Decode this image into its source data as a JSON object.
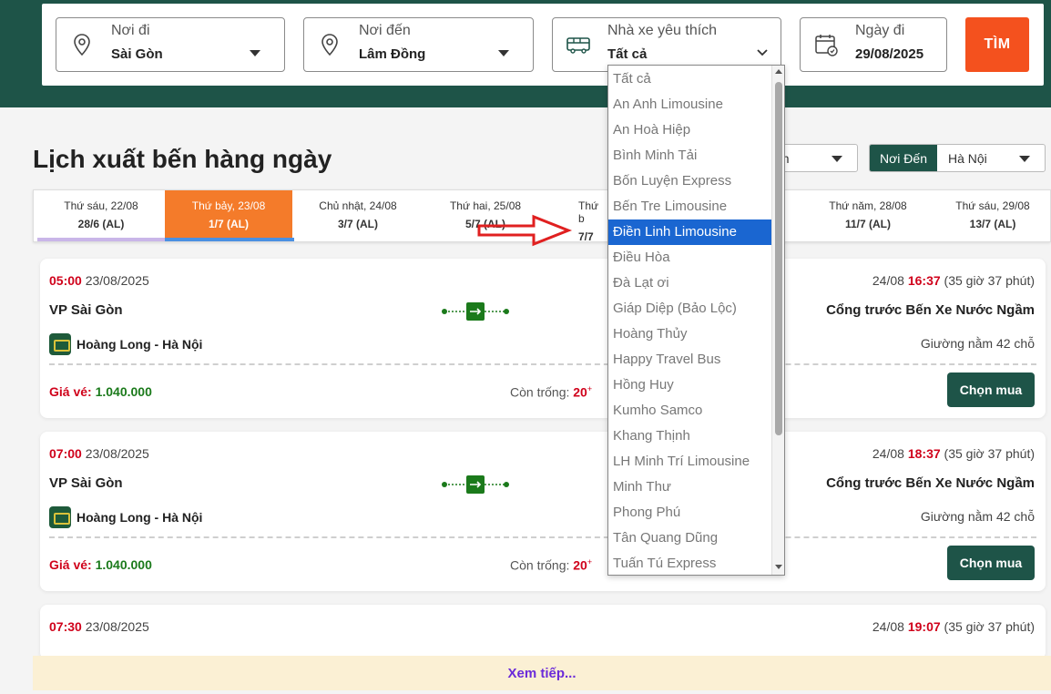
{
  "search": {
    "origin": {
      "label": "Nơi đi",
      "value": "Sài Gòn"
    },
    "destination": {
      "label": "Nơi đến",
      "value": "Lâm Đồng"
    },
    "operator": {
      "label": "Nhà xe yêu thích",
      "value": "Tất cả"
    },
    "date": {
      "label": "Ngày đi",
      "value": "29/08/2025"
    },
    "button_label": "TÌM"
  },
  "page_title": "Lịch xuất bến hàng ngày",
  "filters": {
    "first_value": "ồn",
    "destination_label": "Nơi Đến",
    "destination_value": "Hà Nội"
  },
  "date_tabs": [
    {
      "day": "Thứ sáu, 22/08",
      "lunar": "28/6 (AL)"
    },
    {
      "day": "Thứ bảy, 23/08",
      "lunar": "1/7 (AL)"
    },
    {
      "day": "Chủ nhật, 24/08",
      "lunar": "3/7 (AL)"
    },
    {
      "day": "Thứ hai, 25/08",
      "lunar": "5/7 (AL)"
    },
    {
      "day": "Thứ b",
      "lunar": "7/7"
    },
    {
      "day": "",
      "lunar": ""
    },
    {
      "day": "Thứ năm, 28/08",
      "lunar": "11/7 (AL)"
    },
    {
      "day": "Thứ sáu, 29/08",
      "lunar": "13/7 (AL)"
    }
  ],
  "trips": [
    {
      "depart_time": "05:00",
      "depart_date": "23/08/2025",
      "from": "VP Sài Gòn",
      "operator": "Hoàng Long - Hà Nội",
      "arrive_date": "24/08",
      "arrive_time": "16:37",
      "duration": "(35 giờ 37 phút)",
      "to": "Cổng trước Bến Xe Nước Ngầm",
      "seat_type": "Giường nằm 42 chỗ",
      "price_label": "Giá vé:",
      "price": "1.040.000",
      "avail_label": "Còn trống:",
      "avail": "20",
      "avail_sup": "+",
      "buy_label": "Chọn mua"
    },
    {
      "depart_time": "07:00",
      "depart_date": "23/08/2025",
      "from": "VP Sài Gòn",
      "operator": "Hoàng Long - Hà Nội",
      "arrive_date": "24/08",
      "arrive_time": "18:37",
      "duration": "(35 giờ 37 phút)",
      "to": "Cổng trước Bến Xe Nước Ngầm",
      "seat_type": "Giường nằm 42 chỗ",
      "price_label": "Giá vé:",
      "price": "1.040.000",
      "avail_label": "Còn trống:",
      "avail": "20",
      "avail_sup": "+",
      "buy_label": "Chọn mua"
    },
    {
      "depart_time": "07:30",
      "depart_date": "23/08/2025",
      "arrive_date": "24/08",
      "arrive_time": "19:07",
      "duration": "(35 giờ 37 phút)"
    }
  ],
  "more_label": "Xem tiếp...",
  "operator_dropdown": {
    "items": [
      "Tất cả",
      "An Anh Limousine",
      "An Hoà Hiệp",
      "Bình Minh Tải",
      "Bốn Luyện Express",
      "Bến Tre Limousine",
      "Điền Linh Limousine",
      "Điều Hòa",
      "Đà Lạt ơi",
      "Giáp Diệp (Bảo Lộc)",
      "Hoàng Thủy",
      "Happy Travel Bus",
      "Hồng Huy",
      "Kumho Samco",
      "Khang Thịnh",
      "LH Minh Trí Limousine",
      "Minh Thư",
      "Phong Phú",
      "Tân Quang Dũng",
      "Tuấn Tú Express"
    ],
    "selected_index": 6
  },
  "colors": {
    "brand_green": "#1e5448",
    "accent_orange": "#f4511e",
    "active_tab": "#f47b2a",
    "price_red": "#d0021b",
    "price_green": "#1b7a1b",
    "selected_blue": "#1a66d1",
    "annotation_red": "#e02020"
  },
  "icons": [
    "location-pin-icon",
    "swap-icon",
    "bus-icon",
    "calendar-icon",
    "caret-down-icon",
    "route-bus-icon",
    "operator-logo-icon",
    "red-arrow-annotation"
  ]
}
